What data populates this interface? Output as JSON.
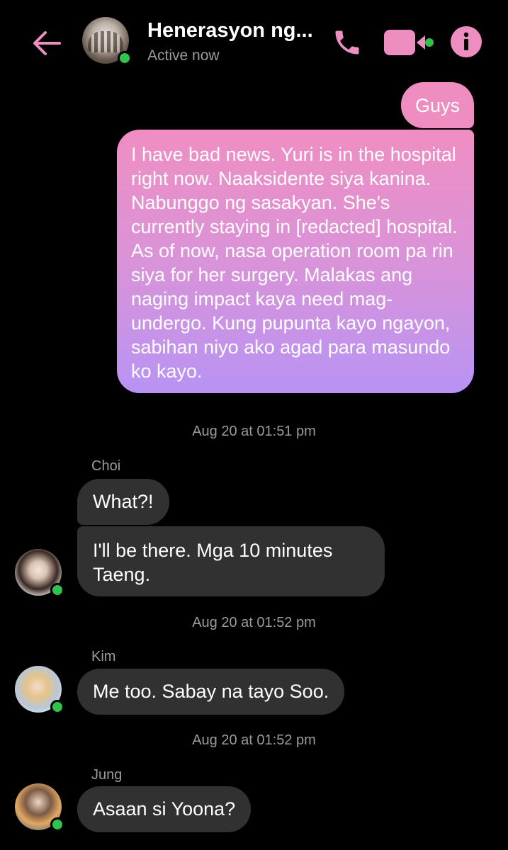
{
  "header": {
    "title": "Henerasyon ng...",
    "status": "Active now",
    "accent_color": "#ee8dc0",
    "icons": [
      "back-arrow-icon",
      "phone-icon",
      "video-camera-icon",
      "info-icon"
    ]
  },
  "messages": {
    "sent_1": "Guys",
    "sent_2": "I have bad news. Yuri is in the hospital right now. Naaksidente siya kanina. Nabunggo ng sasakyan. She's currently staying in [redacted] hospital. As of now, nasa operation room pa rin siya for her surgery. Malakas ang naging impact kaya need mag-undergo. Kung pupunta kayo ngayon, sabihan niyo ako agad para masundo ko kayo.",
    "timestamp_1": "Aug 20 at 01:51 pm",
    "sender_1": "Choi",
    "recv_1": "What?!",
    "recv_2": "I'll be there. Mga 10 minutes Taeng.",
    "timestamp_2": "Aug 20 at 01:52 pm",
    "sender_2": "Kim",
    "recv_3": "Me too. Sabay na tayo Soo.",
    "timestamp_3": "Aug 20 at 01:52 pm",
    "sender_3": "Jung",
    "recv_4": "Asaan si Yoona?"
  }
}
